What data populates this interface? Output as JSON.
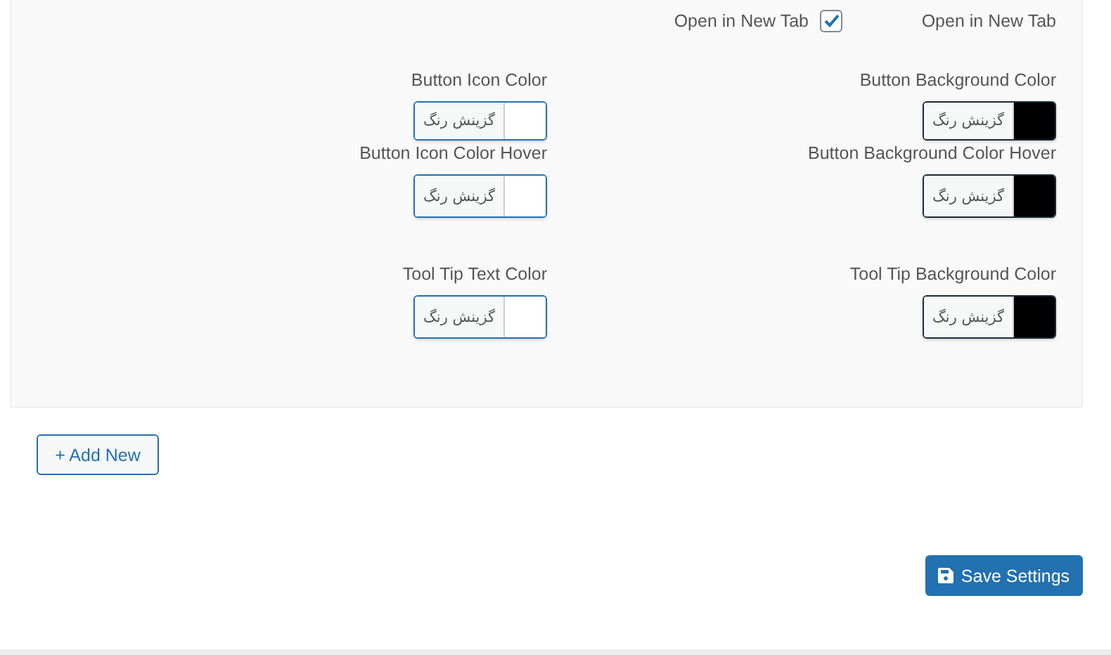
{
  "new_tab": {
    "label": "Open in New Tab",
    "checkbox_label": "Open in New Tab",
    "checked": true
  },
  "color_rows": [
    {
      "right": {
        "label": "Button Background Color",
        "button": "گزینش رنگ",
        "color": "#000000"
      },
      "left": {
        "label": "Button Icon Color",
        "button": "گزینش رنگ",
        "color": "#ffffff"
      }
    },
    {
      "right": {
        "label": "Button Background Color Hover",
        "button": "گزینش رنگ",
        "color": "#000000"
      },
      "left": {
        "label": "Button Icon Color Hover",
        "button": "گزینش رنگ",
        "color": "#ffffff"
      }
    },
    {
      "right": {
        "label": "Tool Tip Background Color",
        "button": "گزینش رنگ",
        "color": "#000000"
      },
      "left": {
        "label": "Tool Tip Text Color",
        "button": "گزینش رنگ",
        "color": "#ffffff"
      }
    }
  ],
  "add_button": "+ Add New",
  "save_button": "Save Settings"
}
